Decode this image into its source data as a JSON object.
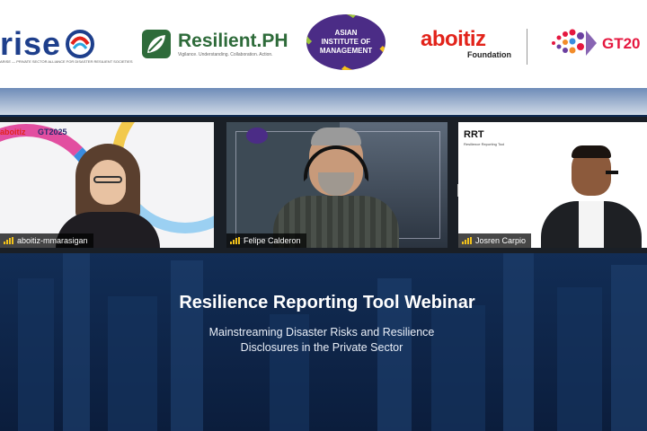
{
  "logos": {
    "arise": {
      "name": "rise",
      "tagline": "ARISE — PRIVATE SECTOR ALLIANCE FOR DISASTER RESILIENT SOCIETIES"
    },
    "resilient_ph": {
      "name": "Resilient.PH",
      "tagline": "Vigilance. Understanding. Collaboration. Action."
    },
    "aim": {
      "name": "ASIAN INSTITUTE OF MANAGEMENT"
    },
    "aboitiz": {
      "name": "aboitiz",
      "sub": "Foundation"
    },
    "gt": {
      "name": "GT20"
    }
  },
  "participants": [
    {
      "name": "aboitiz-mmarasigan",
      "overlay_brand": "aboitiz",
      "overlay_event": "GT2025"
    },
    {
      "name": "Felipe Calderon"
    },
    {
      "name": "Josren Carpio",
      "overlay_brand": "RRT",
      "overlay_sub": "Resilience Reporting Tool"
    }
  ],
  "webinar": {
    "title": "Resilience Reporting Tool Webinar",
    "subtitle_line1": "Mainstreaming Disaster Risks and Resilience",
    "subtitle_line2": "Disclosures in the Private Sector"
  },
  "colors": {
    "background": "#0d2140",
    "title": "#ffffff",
    "signal": "#f2c21b",
    "aboitiz_red": "#e2231a"
  }
}
